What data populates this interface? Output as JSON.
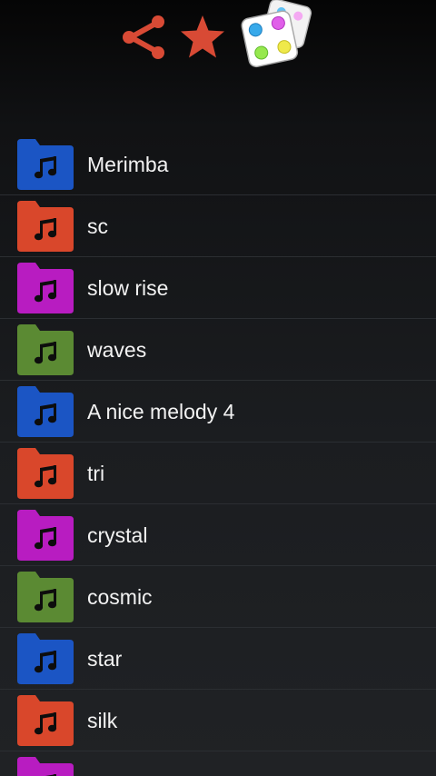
{
  "toolbar": {
    "share_icon": "share-icon",
    "favorite_icon": "star-icon",
    "random_icon": "dice-icon",
    "accent": "#d84a35"
  },
  "folder_colors": {
    "blue": "#1b55c4",
    "orange": "#d9472b",
    "purple": "#b81cc1",
    "green": "#5b8a33"
  },
  "items": [
    {
      "label": "Merimba",
      "color": "blue"
    },
    {
      "label": "sc",
      "color": "orange"
    },
    {
      "label": "slow rise",
      "color": "purple"
    },
    {
      "label": "waves",
      "color": "green"
    },
    {
      "label": "A nice melody 4",
      "color": "blue"
    },
    {
      "label": "tri",
      "color": "orange"
    },
    {
      "label": "crystal",
      "color": "purple"
    },
    {
      "label": "cosmic",
      "color": "green"
    },
    {
      "label": "star",
      "color": "blue"
    },
    {
      "label": "silk",
      "color": "orange"
    },
    {
      "label": "",
      "color": "purple"
    }
  ]
}
